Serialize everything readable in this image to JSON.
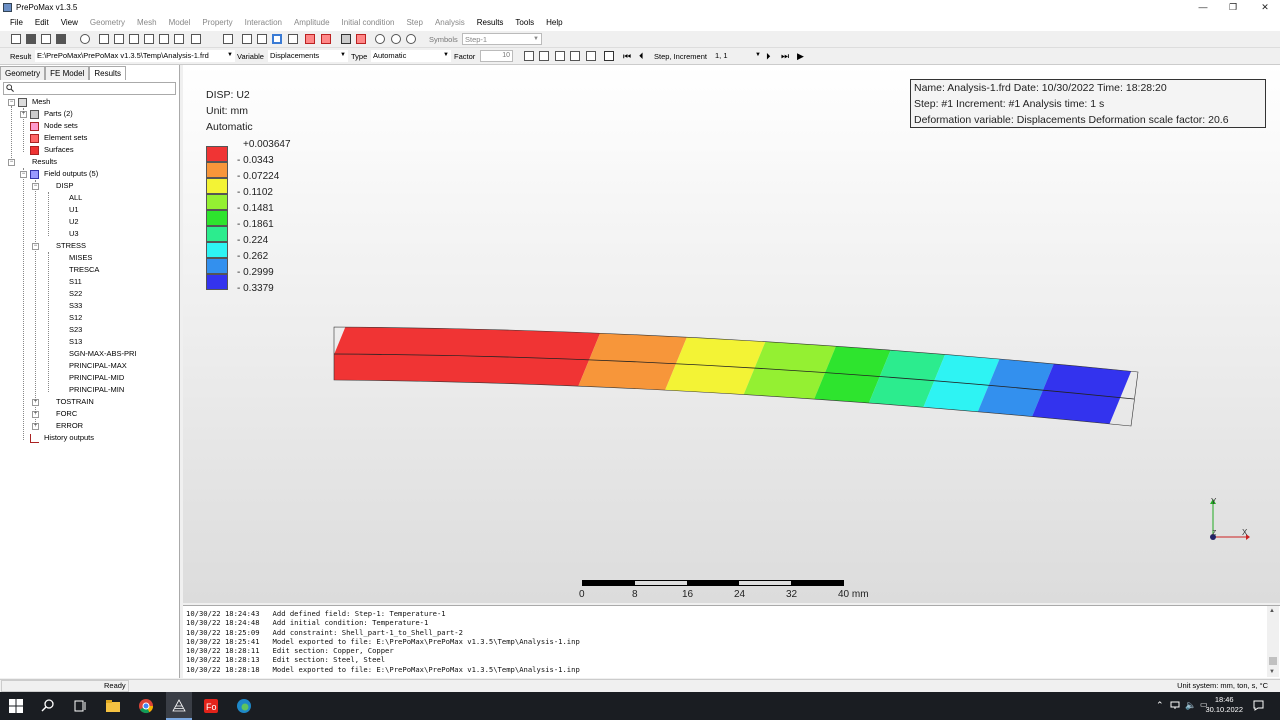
{
  "window": {
    "title": "PrePoMax v1.3.5",
    "minimize": "—",
    "maximize": "❐",
    "close": "✕"
  },
  "menu": [
    "File",
    "Edit",
    "View",
    "Geometry",
    "Mesh",
    "Model",
    "Property",
    "Interaction",
    "Amplitude",
    "Initial condition",
    "Step",
    "Analysis",
    "Results",
    "Tools",
    "Help"
  ],
  "toolbar1": {
    "symbols_label": "Symbols",
    "step_value": "Step-1"
  },
  "toolbar2": {
    "result_label": "Result",
    "result_value": "E:\\PrePoMax\\PrePoMax v1.3.5\\Temp\\Analysis-1.frd",
    "variable_label": "Variable",
    "variable_value": "Displacements",
    "type_label": "Type",
    "type_value": "Automatic",
    "factor_label": "Factor",
    "factor_value": "10",
    "step_increment_label": "Step, Increment",
    "step_increment_value": "1, 1"
  },
  "tabs": [
    "Geometry",
    "FE Model",
    "Results"
  ],
  "tree": {
    "mesh": "Mesh",
    "parts": "Parts (2)",
    "node_sets": "Node sets",
    "element_sets": "Element sets",
    "surfaces": "Surfaces",
    "results": "Results",
    "field_outputs": "Field outputs (5)",
    "disp": "DISP",
    "disp_items": [
      "ALL",
      "U1",
      "U2",
      "U3"
    ],
    "stress": "STRESS",
    "stress_items": [
      "MISES",
      "TRESCA",
      "S11",
      "S22",
      "S33",
      "S12",
      "S23",
      "S13",
      "SGN-MAX-ABS-PRI",
      "PRINCIPAL-MAX",
      "PRINCIPAL-MID",
      "PRINCIPAL-MIN"
    ],
    "tostrain": "TOSTRAIN",
    "forc": "FORC",
    "error": "ERROR",
    "history_outputs": "History outputs"
  },
  "legend": {
    "title": "DISP: U2",
    "unit": "Unit: mm",
    "mode": "Automatic",
    "labels": [
      "+0.003647",
      "- 0.0343",
      "- 0.07224",
      "- 0.1102",
      "- 0.1481",
      "- 0.1861",
      "- 0.224",
      "- 0.262",
      "- 0.2999",
      "- 0.3379"
    ],
    "colors": [
      "#f03434",
      "#f7963a",
      "#f3f335",
      "#94f032",
      "#2ee42e",
      "#2cec8e",
      "#2ef3f3",
      "#3390ee",
      "#3333ee"
    ]
  },
  "info": {
    "line1": "Name: Analysis-1.frd   Date: 10/30/2022   Time: 18:28:20",
    "line2": "Step: #1   Increment: #1   Analysis time: 1 s",
    "line3": "Deformation variable: Displacements   Deformation scale factor: 20.6"
  },
  "scale_labels": [
    "0",
    "8",
    "16",
    "24",
    "32",
    "40 mm"
  ],
  "triad": {
    "y": "Y",
    "z": "Z",
    "x": "X"
  },
  "log": [
    "10/30/22 18:24:43   Add defined field: Step-1: Temperature-1",
    "10/30/22 18:24:48   Add initial condition: Temperature-1",
    "10/30/22 18:25:09   Add constraint: Shell_part-1_to_Shell_part-2",
    "10/30/22 18:25:41   Model exported to file: E:\\PrePoMax\\PrePoMax v1.3.5\\Temp\\Analysis-1.inp",
    "10/30/22 18:28:11   Edit section: Copper, Copper",
    "10/30/22 18:28:13   Edit section: Steel, Steel",
    "10/30/22 18:28:18   Model exported to file: E:\\PrePoMax\\PrePoMax v1.3.5\\Temp\\Analysis-1.inp"
  ],
  "status": {
    "left": "Ready",
    "right": "Unit system: mm, ton, s, °C"
  },
  "taskbar": {
    "time": "18:46",
    "date": "30.10.2022"
  }
}
